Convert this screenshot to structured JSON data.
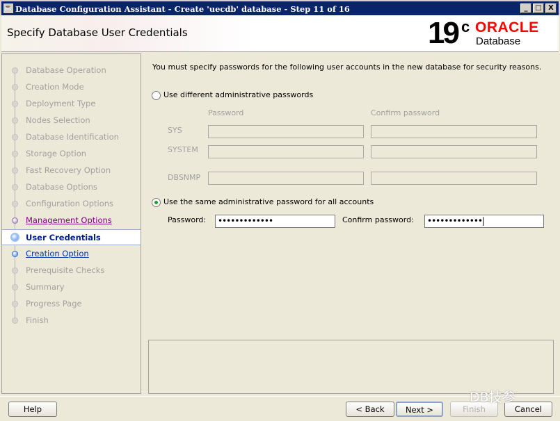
{
  "window": {
    "title": "Database Configuration Assistant - Create 'uecdb' database - Step 11 of 16",
    "minimize": "_",
    "maximize": "□",
    "close": "X"
  },
  "header": {
    "title": "Specify Database User Credentials",
    "logo_version": "19",
    "logo_c": "c",
    "logo_brand": "ORACLE",
    "logo_product": "Database"
  },
  "sidebar": {
    "items": [
      {
        "label": "Database Operation",
        "state": "disabled"
      },
      {
        "label": "Creation Mode",
        "state": "disabled"
      },
      {
        "label": "Deployment Type",
        "state": "disabled"
      },
      {
        "label": "Nodes Selection",
        "state": "disabled"
      },
      {
        "label": "Database Identification",
        "state": "disabled"
      },
      {
        "label": "Storage Option",
        "state": "disabled"
      },
      {
        "label": "Fast Recovery Option",
        "state": "disabled"
      },
      {
        "label": "Database Options",
        "state": "disabled"
      },
      {
        "label": "Configuration Options",
        "state": "disabled"
      },
      {
        "label": "Management Options",
        "state": "visited"
      },
      {
        "label": "User Credentials",
        "state": "current"
      },
      {
        "label": "Creation Option",
        "state": "link"
      },
      {
        "label": "Prerequisite Checks",
        "state": "disabled"
      },
      {
        "label": "Summary",
        "state": "disabled"
      },
      {
        "label": "Progress Page",
        "state": "disabled"
      },
      {
        "label": "Finish",
        "state": "disabled"
      }
    ]
  },
  "main": {
    "intro": "You must specify passwords for the following user accounts in the new database for security reasons.",
    "option_different": "Use different administrative passwords",
    "col_password": "Password",
    "col_confirm": "Confirm password",
    "accounts": [
      "SYS",
      "SYSTEM",
      "DBSNMP"
    ],
    "option_same": "Use the same administrative password for all accounts",
    "selected_option": "same",
    "password_label": "Password:",
    "confirm_label": "Confirm password:",
    "password_value": "•••••••••••••",
    "confirm_value": "•••••••••••••|"
  },
  "buttons": {
    "help": "Help",
    "back": "< Back",
    "next": "Next >",
    "finish": "Finish",
    "cancel": "Cancel"
  },
  "watermark": "DB技参"
}
